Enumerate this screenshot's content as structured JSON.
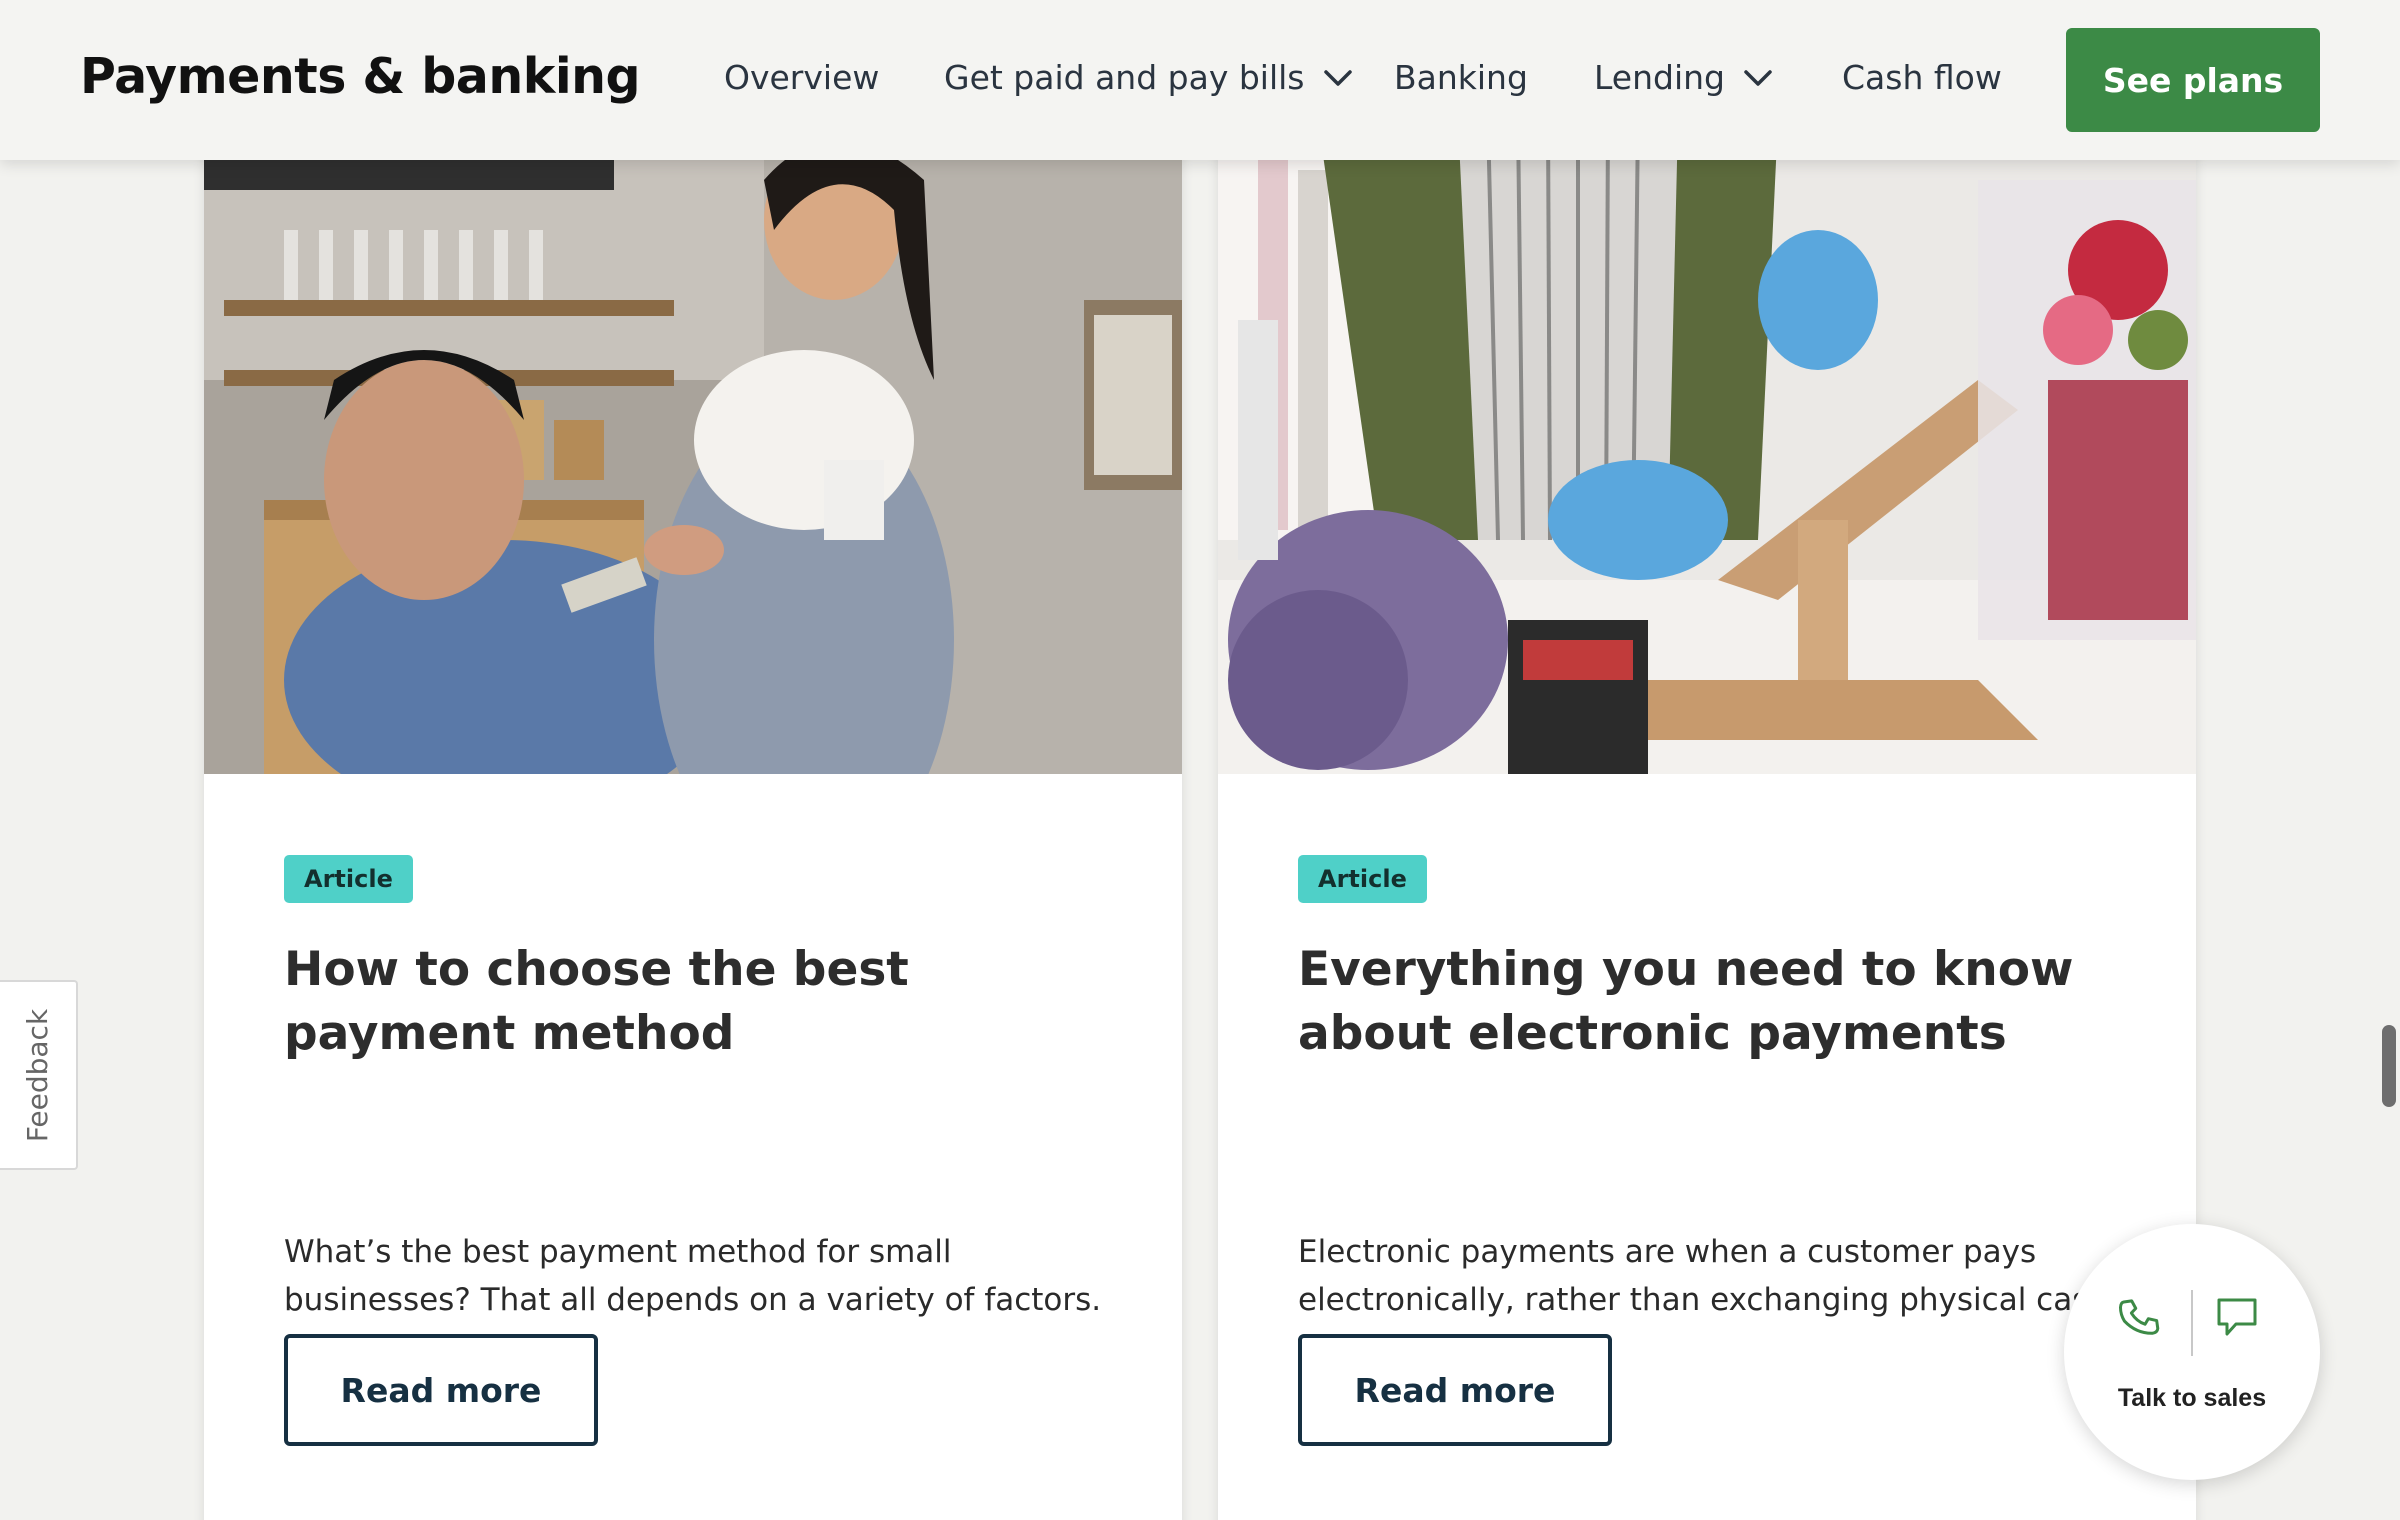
{
  "header": {
    "brand": "Payments & banking",
    "nav": [
      {
        "label": "Overview",
        "has_dropdown": false
      },
      {
        "label": "Get paid and pay bills",
        "has_dropdown": true
      },
      {
        "label": "Banking",
        "has_dropdown": false
      },
      {
        "label": "Lending",
        "has_dropdown": true
      },
      {
        "label": "Cash flow",
        "has_dropdown": false
      }
    ],
    "cta": "See plans"
  },
  "cards": [
    {
      "tag": "Article",
      "title": "How to choose the best payment method",
      "description": "What’s the best payment method for small businesses? That all depends on a variety of factors.",
      "button": "Read more"
    },
    {
      "tag": "Article",
      "title": "Everything you need to know about electronic payments",
      "description": "Electronic payments are when a customer pays electronically, rather than exchanging physical cash or a paper check.",
      "button": "Read more"
    }
  ],
  "feedback": "Feedback",
  "sales_widget": {
    "label": "Talk to sales",
    "icons": [
      "phone-icon",
      "chat-icon"
    ]
  },
  "colors": {
    "brand_green": "#3c8a46",
    "tag_teal": "#4fd0c8",
    "button_navy": "#163042"
  }
}
